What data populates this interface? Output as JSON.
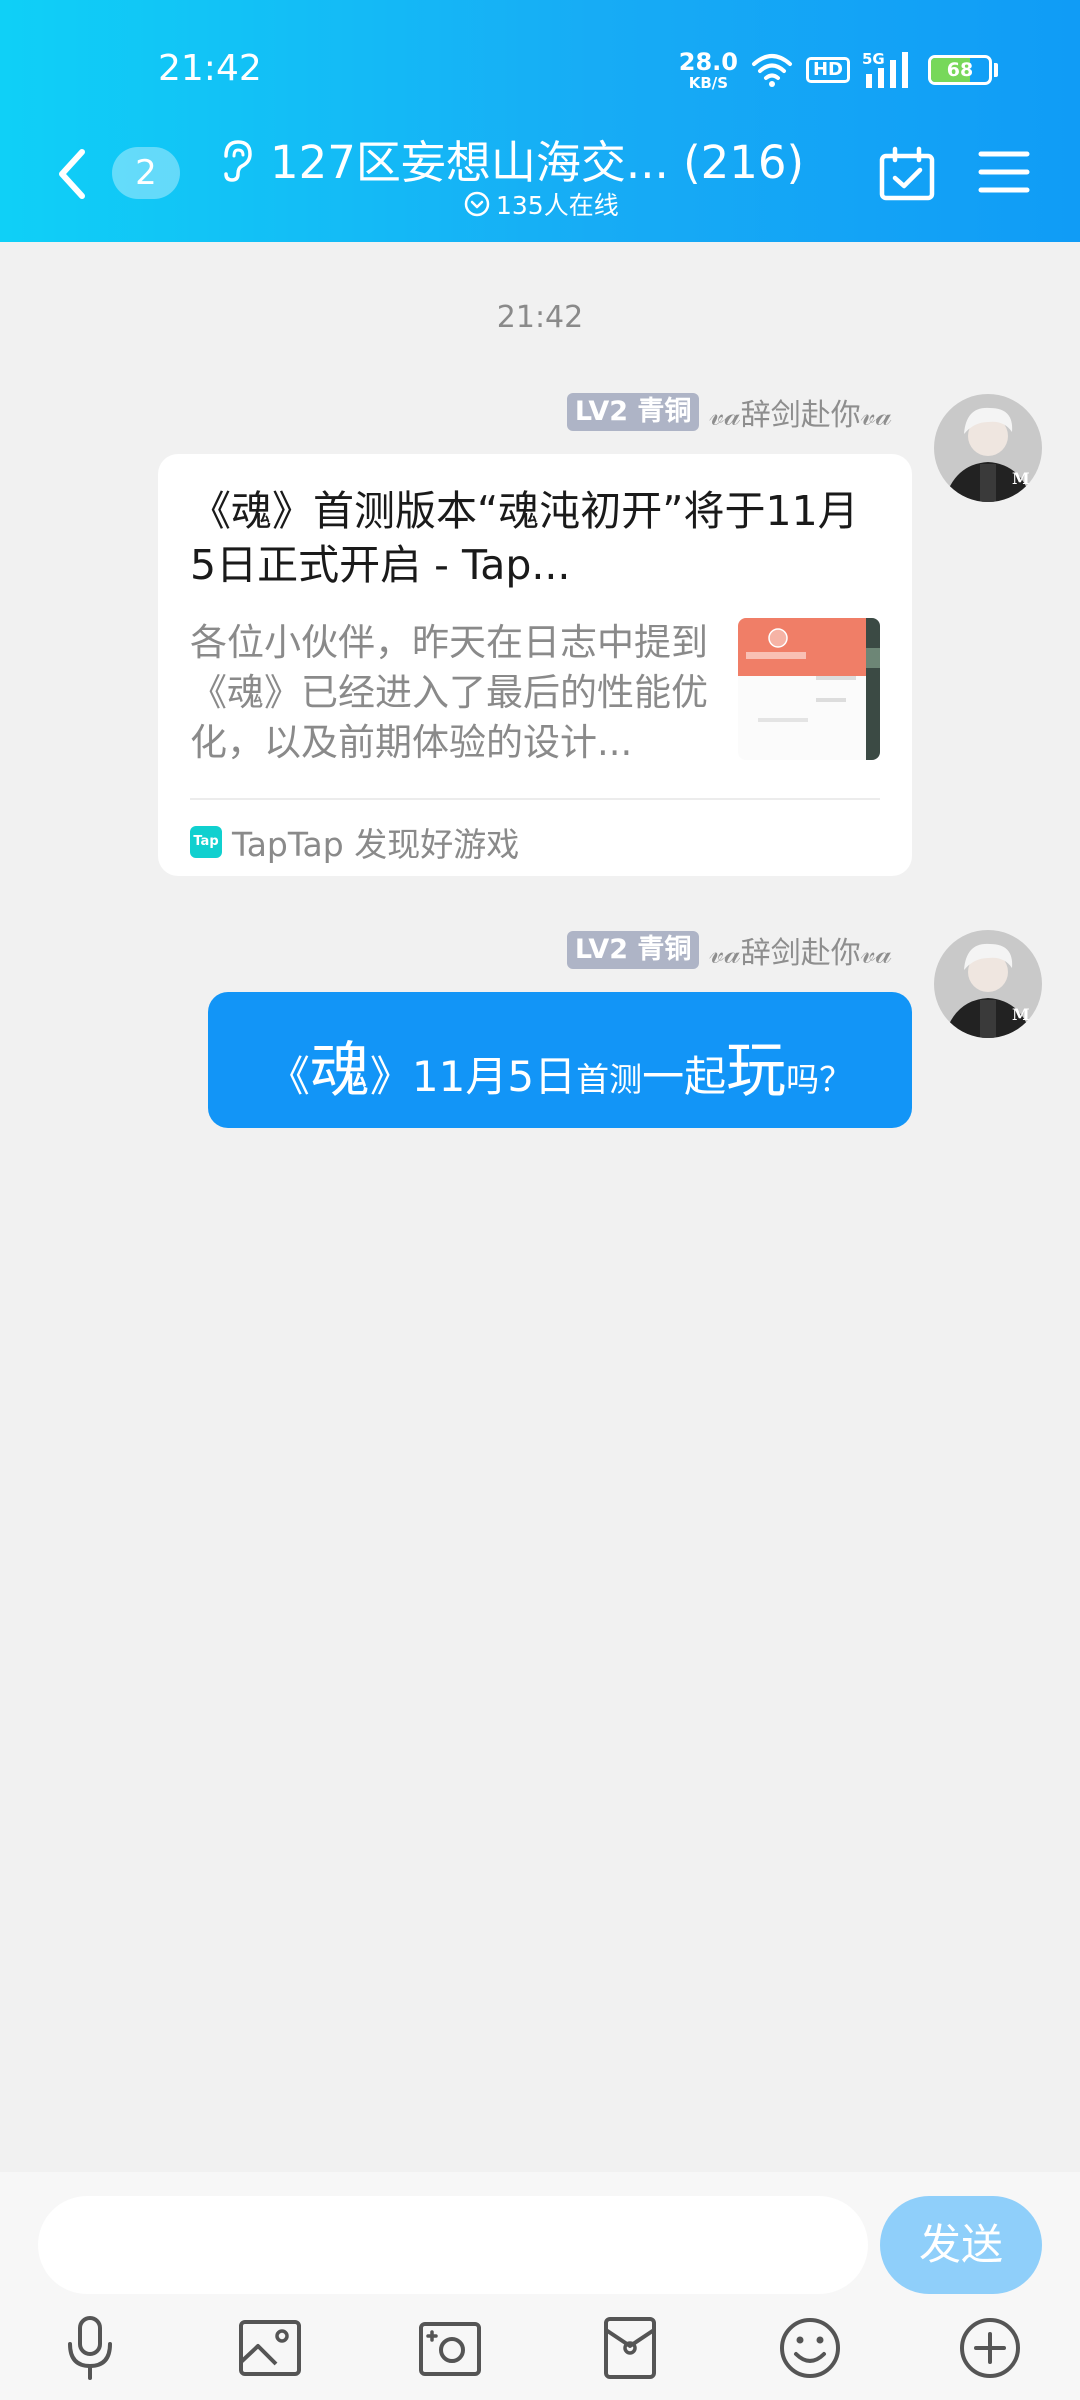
{
  "status_bar": {
    "time": "21:42",
    "net_speed": "28.0",
    "net_unit": "KB/S",
    "hd": "HD",
    "signal_label": "5G",
    "battery": "68",
    "battery_level": 0.68
  },
  "header": {
    "unread_count": "2",
    "title": "127区妄想山海交... (216)",
    "online": "135人在线",
    "icons": [
      "back-arrow-icon",
      "ear-icon",
      "calendar-check-icon",
      "menu-icon"
    ]
  },
  "chat": {
    "timestamp": "21:42",
    "messages": [
      {
        "sender": {
          "level": "LV2 青铜",
          "name": "𝓋𝒶辞剑赴你𝓋𝒶"
        },
        "card": {
          "title": "《魂》首测版本“魂沌初开”将于11月5日正式开启 - Tap...",
          "description": "各位小伙伴，昨天在日志中提到《魂》已经进入了最后的性能优化，以及前期体验的设计...",
          "source": "TapTap 发现好游戏",
          "source_logo": "Tap"
        }
      },
      {
        "sender": {
          "level": "LV2 青铜",
          "name": "𝓋𝒶辞剑赴你𝓋𝒶"
        },
        "text_parts": [
          "《",
          "魂",
          "》",
          "11月5日",
          "首测",
          "一起",
          "玩",
          "吗？"
        ]
      }
    ]
  },
  "input": {
    "placeholder": "",
    "send_label": "发送",
    "toolbar": [
      "microphone-icon",
      "image-icon",
      "camera-icon",
      "red-packet-icon",
      "emoji-icon",
      "plus-icon"
    ]
  },
  "colors": {
    "header_start": "#0fd0f7",
    "header_end": "#109cf6",
    "bubble": "#1295f7",
    "send_button": "#8fcffa",
    "background": "#f1f1f1"
  }
}
